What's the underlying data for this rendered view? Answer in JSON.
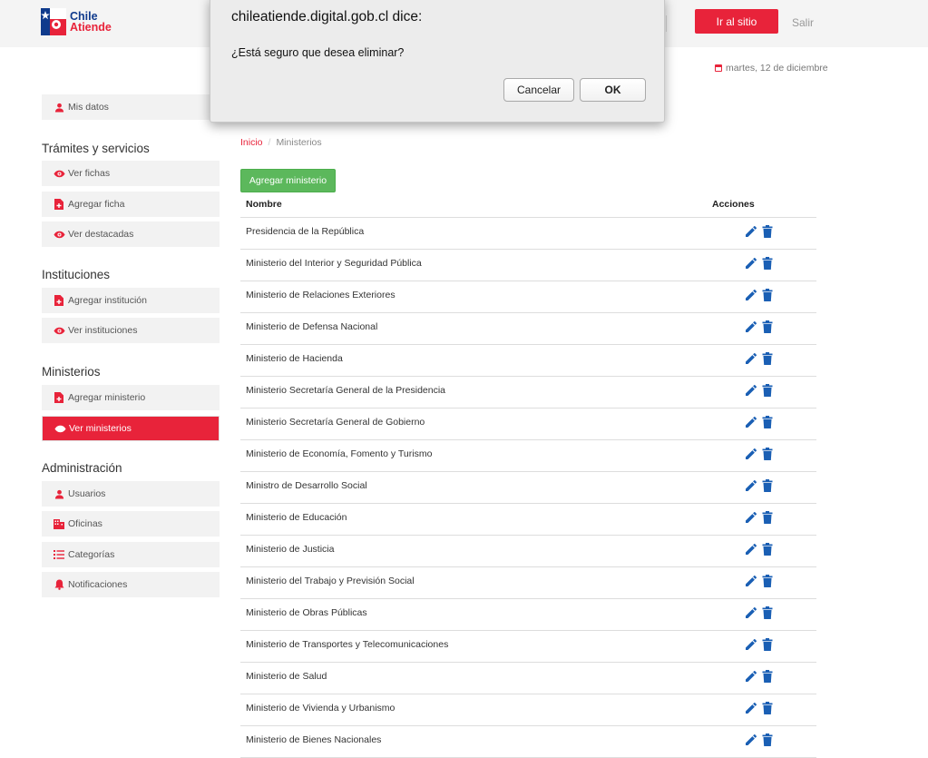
{
  "header": {
    "logo_line1": "Chile",
    "logo_line2": "Atiende",
    "site_button": "Ir al sitio",
    "logout": "Salir",
    "date": "martes, 12 de diciembre"
  },
  "sidebar": {
    "profile": {
      "label": "Mis datos",
      "icon": "user-icon"
    },
    "sections": [
      {
        "title": "Trámites y servicios",
        "items": [
          {
            "label": "Ver fichas",
            "icon": "eye-icon"
          },
          {
            "label": "Agregar ficha",
            "icon": "file-add-icon"
          },
          {
            "label": "Ver destacadas",
            "icon": "eye-icon"
          }
        ]
      },
      {
        "title": "Instituciones",
        "items": [
          {
            "label": "Agregar institución",
            "icon": "file-add-icon"
          },
          {
            "label": "Ver instituciones",
            "icon": "eye-icon"
          }
        ]
      },
      {
        "title": "Ministerios",
        "items": [
          {
            "label": "Agregar ministerio",
            "icon": "file-add-icon"
          },
          {
            "label": "Ver ministerios",
            "icon": "eye-icon",
            "active": true
          }
        ]
      },
      {
        "title": "Administración",
        "items": [
          {
            "label": "Usuarios",
            "icon": "user-icon"
          },
          {
            "label": "Oficinas",
            "icon": "building-icon"
          },
          {
            "label": "Categorías",
            "icon": "list-icon"
          },
          {
            "label": "Notificaciones",
            "icon": "bell-icon"
          }
        ]
      }
    ]
  },
  "main": {
    "breadcrumb": {
      "home": "Inicio",
      "current": "Ministerios"
    },
    "add_button": "Agregar ministerio",
    "columns": {
      "name": "Nombre",
      "actions": "Acciones"
    },
    "rows": [
      "Presidencia de la República",
      "Ministerio del Interior y Seguridad Pública",
      "Ministerio de Relaciones Exteriores",
      "Ministerio de Defensa Nacional",
      "Ministerio de Hacienda",
      "Ministerio Secretaría General de la Presidencia",
      "Ministerio Secretaría General de Gobierno",
      "Ministerio de Economía, Fomento y Turismo",
      "Ministro de Desarrollo Social",
      "Ministerio de Educación",
      "Ministerio de Justicia",
      "Ministerio del Trabajo y Previsión Social",
      "Ministerio de Obras Públicas",
      "Ministerio de Transportes y Telecomunicaciones",
      "Ministerio de Salud",
      "Ministerio de Vivienda y Urbanismo",
      "Ministerio de Bienes Nacionales"
    ]
  },
  "dialog": {
    "title": "chileatiende.digital.gob.cl dice:",
    "message": "¿Está seguro que desea eliminar?",
    "cancel": "Cancelar",
    "ok": "OK"
  },
  "colors": {
    "brand_red": "#e8233a",
    "brand_blue": "#0f3a8c",
    "action_blue": "#1a5fb4",
    "add_green": "#5cb85c"
  }
}
